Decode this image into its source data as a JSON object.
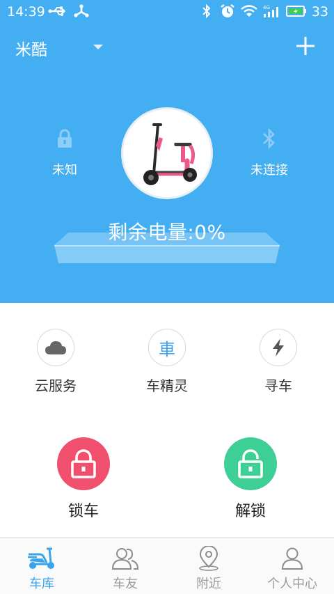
{
  "status_bar": {
    "time": "14:39",
    "battery_level": "33",
    "icons": [
      "usb-icon",
      "share-icon",
      "bluetooth-icon",
      "alarm-icon",
      "wifi-icon",
      "signal-4g-icon",
      "battery-icon"
    ]
  },
  "header": {
    "title": "米酷",
    "dropdown_icon": "caret-down-icon",
    "add_icon": "plus-icon"
  },
  "vehicle": {
    "lock_status_label": "未知",
    "bluetooth_status_label": "未连接",
    "battery_text": "剩余电量:0%",
    "battery_level_percent": 0,
    "image": "scooter-image"
  },
  "functions": [
    {
      "label": "云服务",
      "icon": "cloud-icon"
    },
    {
      "label": "车精灵",
      "icon": "car-spirit-icon",
      "glyph": "車"
    },
    {
      "label": "寻车",
      "icon": "lightning-icon"
    }
  ],
  "actions": {
    "lock_label": "锁车",
    "unlock_label": "解锁"
  },
  "nav": {
    "items": [
      {
        "label": "车库",
        "icon": "scooter-icon",
        "active": true
      },
      {
        "label": "车友",
        "icon": "friends-icon",
        "active": false
      },
      {
        "label": "附近",
        "icon": "location-pin-icon",
        "active": false
      },
      {
        "label": "个人中心",
        "icon": "person-icon",
        "active": false
      }
    ]
  },
  "colors": {
    "primary_blue": "#44aef2",
    "lock_red": "#f04f6e",
    "unlock_green": "#3ecf97",
    "nav_active": "#3aa3ec",
    "nav_inactive": "#9a9a9a"
  }
}
